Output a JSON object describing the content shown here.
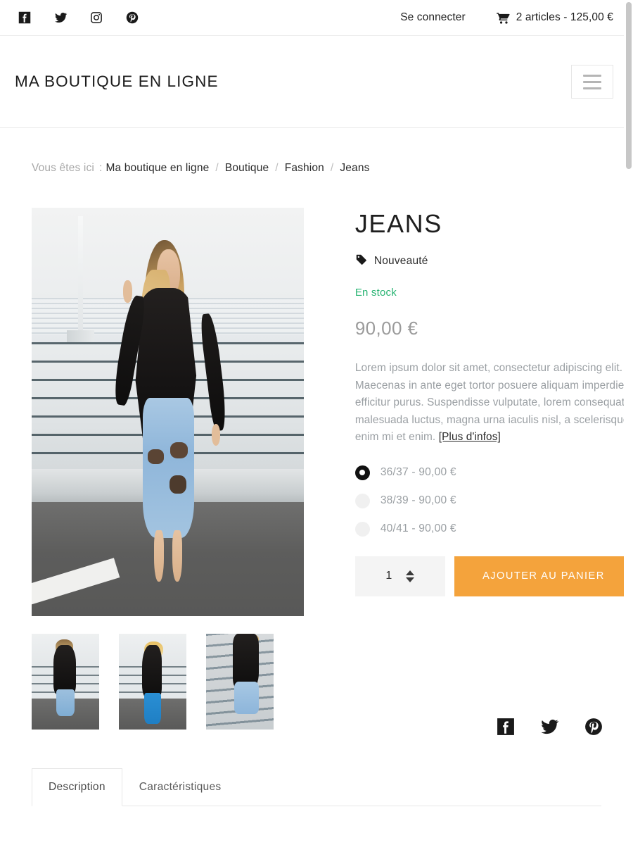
{
  "topbar": {
    "social": [
      {
        "name": "facebook-icon",
        "label": "Facebook"
      },
      {
        "name": "twitter-icon",
        "label": "Twitter"
      },
      {
        "name": "instagram-icon",
        "label": "Instagram"
      },
      {
        "name": "pinterest-icon",
        "label": "Pinterest"
      }
    ],
    "login_label": "Se connecter",
    "cart_label": "2 articles - 125,00 €",
    "cart_icon": "cart-icon"
  },
  "header": {
    "site_title": "MA BOUTIQUE EN LIGNE",
    "menu_icon": "hamburger-icon"
  },
  "breadcrumb": {
    "prefix": "Vous êtes ici",
    "colon": ":",
    "items": [
      "Ma boutique en ligne",
      "Boutique",
      "Fashion",
      "Jeans"
    ],
    "separator": "/"
  },
  "product": {
    "title": "JEANS",
    "badge": "Nouveauté",
    "badge_icon": "tag-icon",
    "stock": "En stock",
    "price": "90,00 €",
    "description": "Lorem ipsum dolor sit amet, consectetur adipiscing elit. Maecenas in ante eget tortor posuere aliquam imperdiet efficitur purus. Suspendisse vulputate, lorem consequat malesuada luctus, magna urna iaculis nisl, a scelerisque enim mi et enim. ",
    "more_info": "[Plus d'infos]",
    "options": [
      {
        "label": "36/37 - 90,00 €",
        "selected": true
      },
      {
        "label": "38/39 - 90,00 €",
        "selected": false
      },
      {
        "label": "40/41 - 90,00 €",
        "selected": false
      }
    ],
    "quantity": "1",
    "add_to_cart_label": "AJOUTER AU PANIER",
    "share": [
      {
        "name": "facebook-icon",
        "label": "Facebook"
      },
      {
        "name": "twitter-icon",
        "label": "Twitter"
      },
      {
        "name": "pinterest-icon",
        "label": "Pinterest"
      }
    ]
  },
  "tabs": [
    {
      "label": "Description",
      "active": true
    },
    {
      "label": "Caractéristiques",
      "active": false
    }
  ],
  "colors": {
    "accent_orange": "#f4a33c",
    "stock_green": "#29b473",
    "price_gray": "#9b9b9b",
    "text_dark": "#1e1e1e",
    "muted": "#9a9fa3"
  }
}
